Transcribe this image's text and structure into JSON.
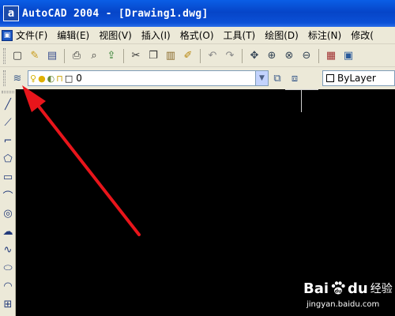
{
  "window": {
    "app_icon_letter": "a",
    "title": "AutoCAD 2004 - [Drawing1.dwg]"
  },
  "menubar": {
    "doc_icon": "doc-icon",
    "items": [
      {
        "label": "文件(F)"
      },
      {
        "label": "编辑(E)"
      },
      {
        "label": "视图(V)"
      },
      {
        "label": "插入(I)"
      },
      {
        "label": "格式(O)"
      },
      {
        "label": "工具(T)"
      },
      {
        "label": "绘图(D)"
      },
      {
        "label": "标注(N)"
      },
      {
        "label": "修改("
      }
    ]
  },
  "standard_toolbar": {
    "icons": [
      "new-icon",
      "open-icon",
      "save-icon",
      "print-icon",
      "print-preview-icon",
      "publish-icon",
      "cut-icon",
      "copy-icon",
      "paste-icon",
      "match-properties-icon",
      "undo-icon",
      "redo-icon",
      "pan-icon",
      "zoom-realtime-icon",
      "zoom-window-icon",
      "zoom-previous-icon",
      "properties-icon",
      "design-center-icon"
    ]
  },
  "layers_toolbar": {
    "current_layer": "0",
    "color_value": "ByLayer"
  },
  "draw_toolbar": {
    "tools": [
      "line-icon",
      "construction-line-icon",
      "polyline-icon",
      "polygon-icon",
      "rectangle-icon",
      "arc-icon",
      "circle-icon",
      "revision-cloud-icon",
      "spline-icon",
      "ellipse-icon",
      "ellipse-arc-icon",
      "insert-block-icon"
    ]
  },
  "watermark": {
    "brand_left": "Bai",
    "brand_right": "du",
    "suffix": "经验",
    "url": "jingyan.baidu.com"
  },
  "colors": {
    "titlebar": "#0645c8",
    "canvas": "#000000",
    "annotation_arrow": "#e8151b",
    "chrome": "#ece9d8"
  }
}
